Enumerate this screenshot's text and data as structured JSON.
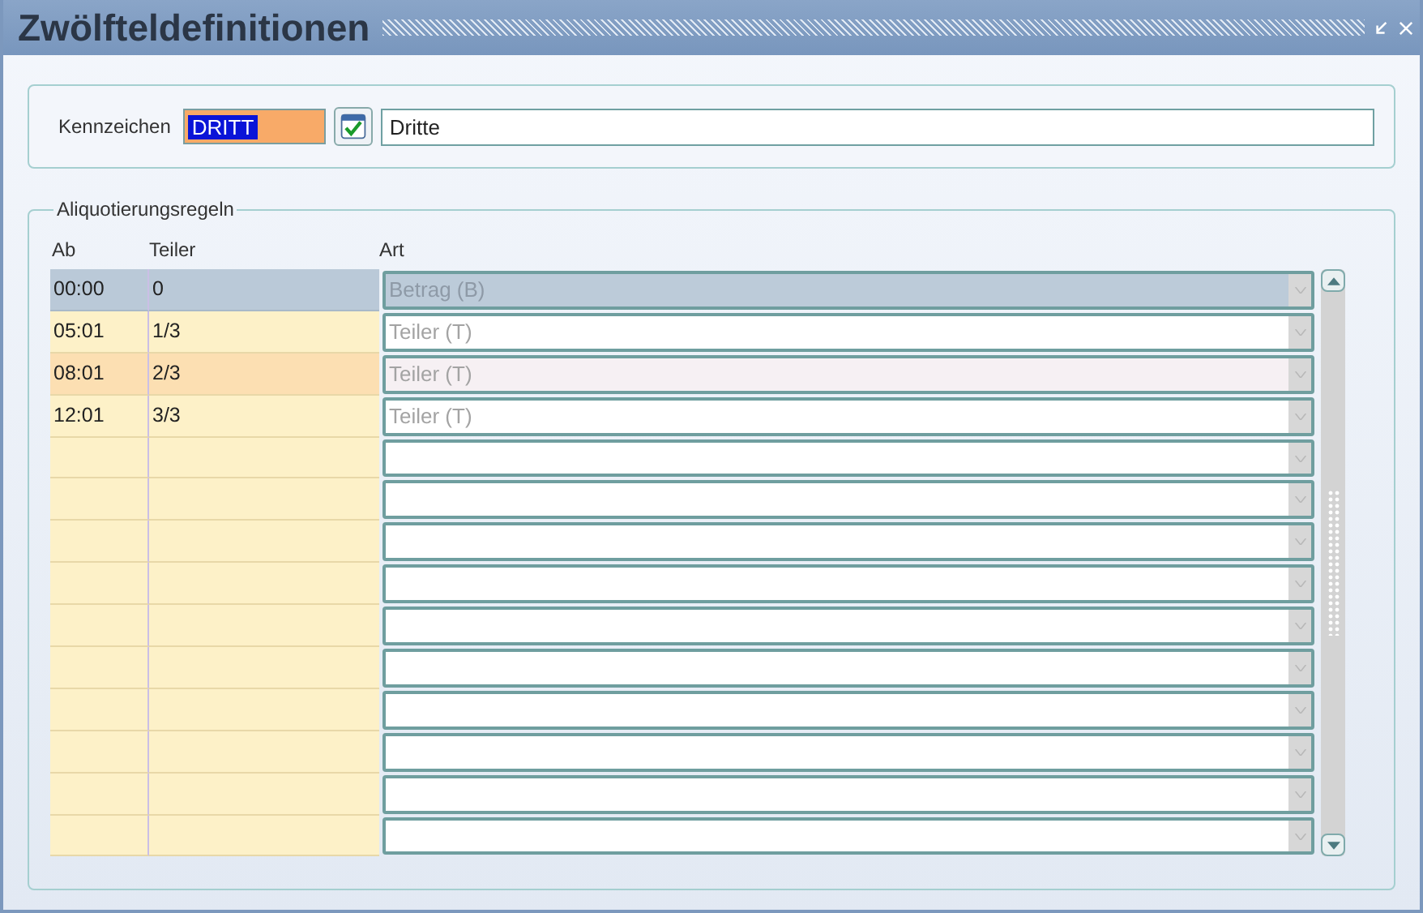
{
  "window": {
    "title": "Zwölfteldefinitionen"
  },
  "header": {
    "label": "Kennzeichen",
    "code": "DRITT",
    "code_selected": true,
    "description": "Dritte"
  },
  "rules": {
    "title": "Aliquotierungsregeln",
    "columns": [
      "Ab",
      "Teiler",
      "Art"
    ],
    "rows": [
      {
        "ab": "00:00",
        "teiler": "0",
        "art": "Betrag (B)",
        "selected": true,
        "current": false
      },
      {
        "ab": "05:01",
        "teiler": "1/3",
        "art": "Teiler (T)",
        "selected": false,
        "current": false
      },
      {
        "ab": "08:01",
        "teiler": "2/3",
        "art": "Teiler (T)",
        "selected": false,
        "current": true
      },
      {
        "ab": "12:01",
        "teiler": "3/3",
        "art": "Teiler (T)",
        "selected": false,
        "current": false
      },
      {
        "selected": false,
        "current": false
      },
      {
        "selected": false,
        "current": false
      },
      {
        "selected": false,
        "current": false
      },
      {
        "selected": false,
        "current": false
      },
      {
        "selected": false,
        "current": false
      },
      {
        "selected": false,
        "current": false
      },
      {
        "selected": false,
        "current": false
      },
      {
        "selected": false,
        "current": false
      },
      {
        "selected": false,
        "current": false
      },
      {
        "selected": false,
        "current": false
      }
    ]
  }
}
